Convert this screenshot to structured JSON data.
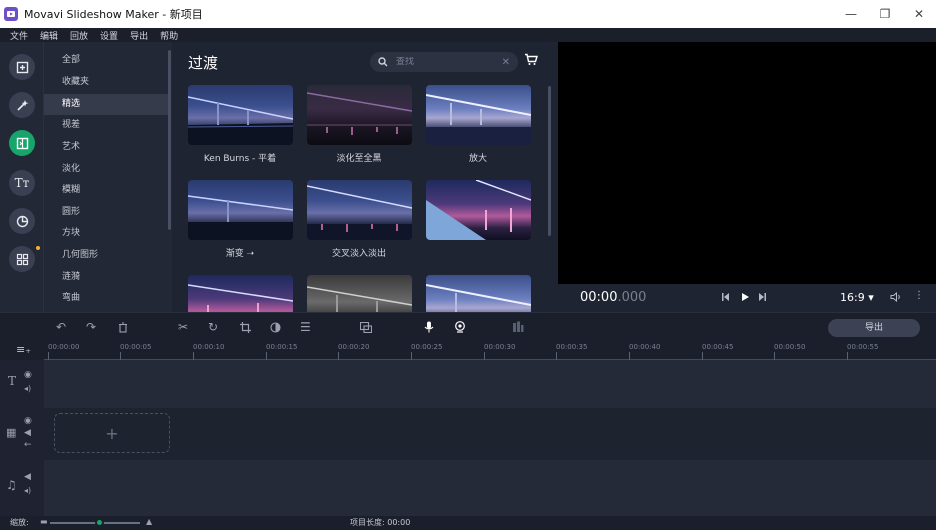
{
  "window": {
    "title": "Movavi Slideshow Maker - 新项目",
    "minimize": "—",
    "restore": "❐",
    "close": "✕"
  },
  "menu": [
    "文件",
    "编辑",
    "回放",
    "设置",
    "导出",
    "帮助"
  ],
  "rail": {
    "icons": [
      "import-icon",
      "magic-wand-icon",
      "transitions-icon",
      "titles-icon",
      "stickers-icon",
      "more-icon"
    ],
    "active_index": 2
  },
  "categories": {
    "items": [
      "全部",
      "收藏夹",
      "精选",
      "视差",
      "艺术",
      "淡化",
      "模糊",
      "圆形",
      "方块",
      "几何图形",
      "涟漪",
      "弯曲"
    ],
    "selected_index": 2
  },
  "panel": {
    "title": "过渡",
    "search_placeholder": "查找",
    "thumbnails": [
      {
        "label": "Ken Burns - 平着"
      },
      {
        "label": "淡化至全黑"
      },
      {
        "label": "放大"
      },
      {
        "label": "渐变 ➝"
      },
      {
        "label": "交叉淡入淡出"
      },
      {
        "label": ""
      },
      {
        "label": ""
      },
      {
        "label": ""
      },
      {
        "label": ""
      }
    ]
  },
  "player": {
    "time_main": "00:00",
    "time_ms": ".000",
    "aspect": "16:9 ▾"
  },
  "toolbar": {
    "export_label": "导出"
  },
  "ruler": {
    "ticks": [
      "00:00:00",
      "00:00:05",
      "00:00:10",
      "00:00:15",
      "00:00:20",
      "00:00:25",
      "00:00:30",
      "00:00:35",
      "00:00:40",
      "00:00:45",
      "00:00:50",
      "00:00:55"
    ]
  },
  "status": {
    "scale_label": "缩放:",
    "zoom_level": 0.55,
    "duration_label": "项目长度: 00:00"
  },
  "colors": {
    "accent": "#16a66b",
    "dot": "#f0b429",
    "app_logo": "#6d4fc7"
  }
}
